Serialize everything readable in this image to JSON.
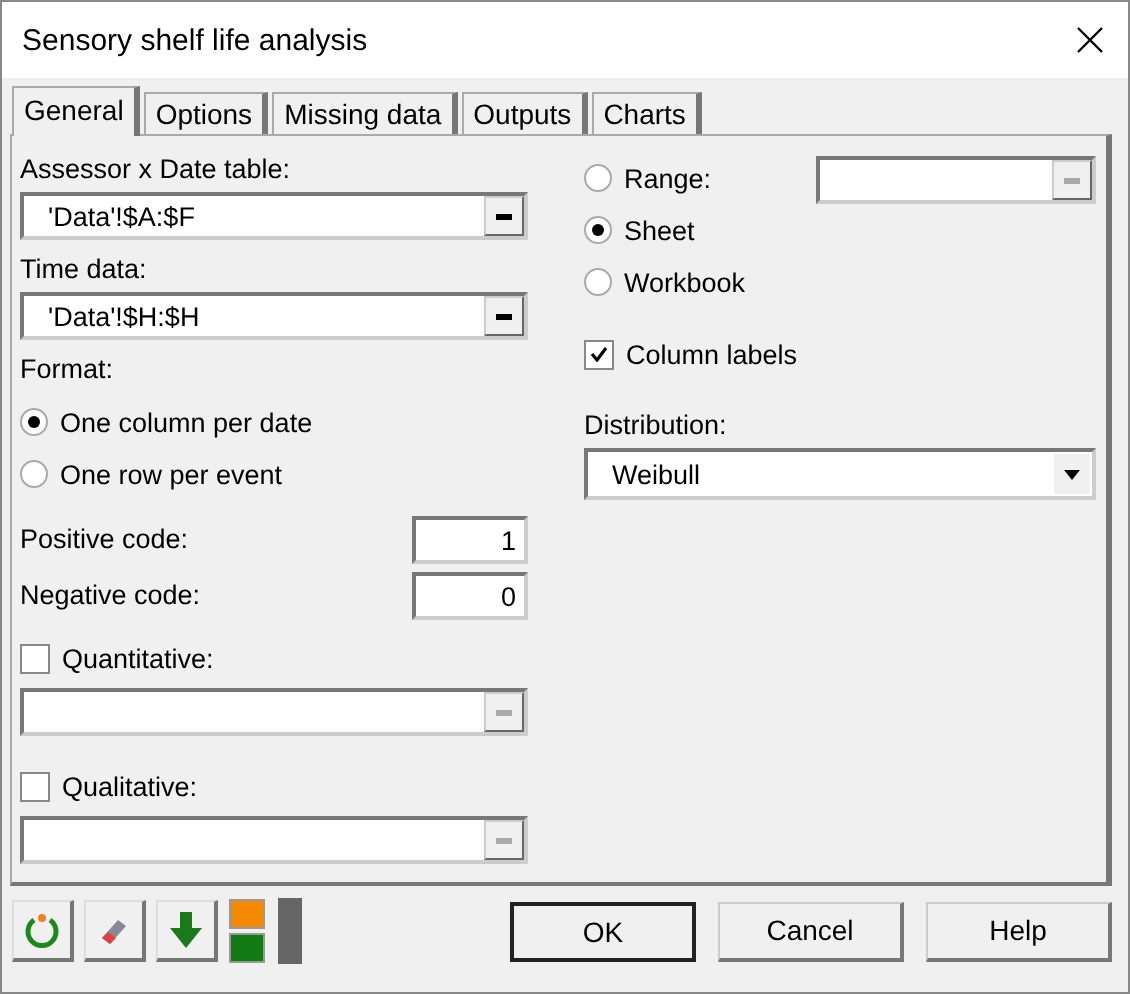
{
  "window": {
    "title": "Sensory shelf life analysis"
  },
  "tabs": [
    {
      "label": "General",
      "selected": true
    },
    {
      "label": "Options",
      "selected": false
    },
    {
      "label": "Missing data",
      "selected": false
    },
    {
      "label": "Outputs",
      "selected": false
    },
    {
      "label": "Charts",
      "selected": false
    }
  ],
  "assessor_table": {
    "label": "Assessor x Date table:",
    "value": "'Data'!$A:$F",
    "disabled": false
  },
  "time_data": {
    "label": "Time data:",
    "value": "'Data'!$H:$H",
    "disabled": false
  },
  "format": {
    "label": "Format:",
    "options": [
      {
        "label": "One column per date",
        "selected": true
      },
      {
        "label": "One row per event",
        "selected": false
      }
    ]
  },
  "codes": [
    {
      "label": "Positive code:",
      "value": "1"
    },
    {
      "label": "Negative code:",
      "value": "0"
    }
  ],
  "optional_fields": [
    {
      "label": "Quantitative:",
      "checked": false,
      "disabled": true
    },
    {
      "label": "Qualitative:",
      "checked": false,
      "disabled": true
    }
  ],
  "output_target": [
    {
      "label": "Range:",
      "selected": false
    },
    {
      "label": "Sheet",
      "selected": true
    },
    {
      "label": "Workbook",
      "selected": false
    }
  ],
  "range_field": {
    "disabled": true
  },
  "column_labels": {
    "label": "Column labels",
    "checked": true
  },
  "distribution": {
    "label": "Distribution:",
    "value": "Weibull"
  },
  "buttons": [
    "OK",
    "Cancel",
    "Help"
  ]
}
